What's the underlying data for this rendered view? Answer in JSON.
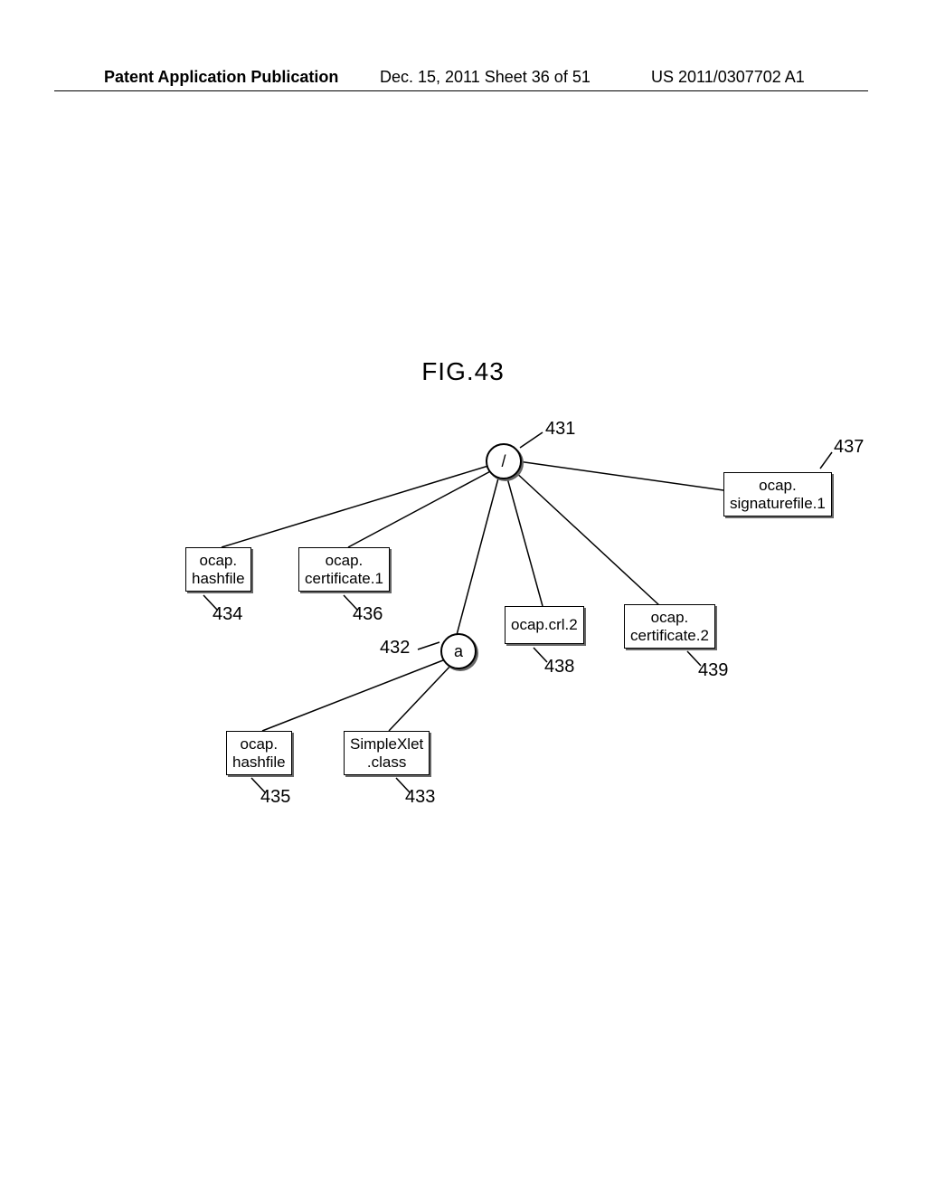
{
  "header": {
    "left": "Patent Application Publication",
    "mid": "Dec. 15, 2011  Sheet 36 of 51",
    "right": "US 2011/0307702 A1"
  },
  "figure_title": "FIG.43",
  "nodes": {
    "root": {
      "label": "/",
      "ref": "431"
    },
    "sub_a": {
      "label": "a",
      "ref": "432"
    },
    "box_hashfile1": {
      "line1": "ocap.",
      "line2": "hashfile",
      "ref": "434"
    },
    "box_cert1": {
      "line1": "ocap.",
      "line2": "certificate.1",
      "ref": "436"
    },
    "box_sigfile": {
      "line1": "ocap.",
      "line2": "signaturefile.1",
      "ref": "437"
    },
    "box_crl2": {
      "line1": "ocap.crl.2",
      "ref": "438"
    },
    "box_cert2": {
      "line1": "ocap.",
      "line2": "certificate.2",
      "ref": "439"
    },
    "box_hashfile2": {
      "line1": "ocap.",
      "line2": "hashfile",
      "ref": "435"
    },
    "box_simplexlet": {
      "line1": "SimpleXlet",
      "line2": ".class",
      "ref": "433"
    }
  }
}
